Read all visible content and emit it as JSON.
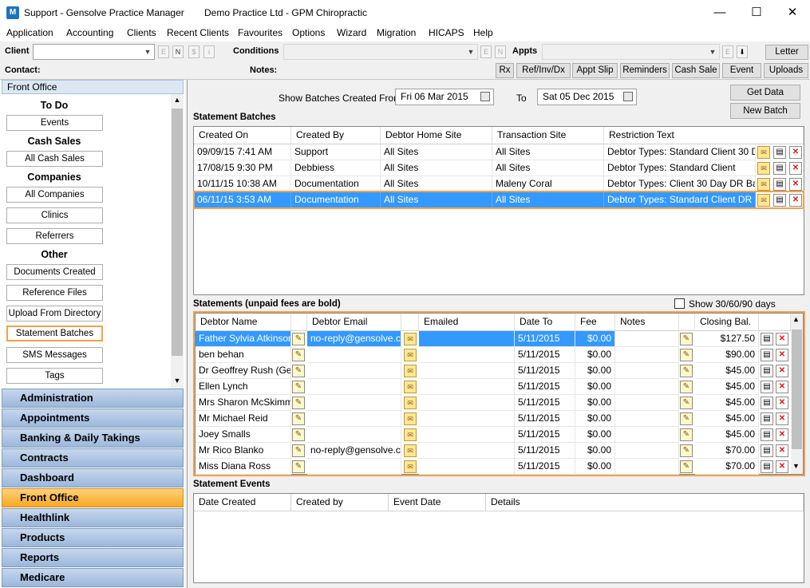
{
  "window": {
    "title": "Support - Gensolve Practice Manager",
    "subtitle": "Demo Practice Ltd - GPM Chiropractic",
    "app_icon": "gensolve-logo-icon",
    "controls": {
      "minimize": "—",
      "maximize": "☐",
      "close": "✕"
    }
  },
  "menu": [
    "Application",
    "Accounting",
    "Clients",
    "Recent Clients",
    "Favourites",
    "Options",
    "Wizard",
    "Migration",
    "HICAPS",
    "Help"
  ],
  "toolbar": {
    "client_label": "Client",
    "client_value": "",
    "client_btns": [
      "E",
      "N",
      "$",
      "i"
    ],
    "conditions_label": "Conditions",
    "conditions_btns": [
      "E",
      "N"
    ],
    "appts_label": "Appts",
    "appts_btns": [
      "E",
      "⬇"
    ],
    "contact_label": "Contact:",
    "notes_label": "Notes:",
    "letter": "Letter",
    "buttons": [
      "Rx",
      "Ref/Inv/Dx",
      "Appt Slip",
      "Reminders",
      "Cash Sale",
      "Event",
      "Uploads"
    ]
  },
  "sidebar": {
    "header": "Front Office",
    "groups": [
      {
        "title": "To Do",
        "items": [
          "Events"
        ]
      },
      {
        "title": "Cash Sales",
        "items": [
          "All Cash Sales"
        ]
      },
      {
        "title": "Companies",
        "items": [
          "All Companies",
          "Clinics",
          "Referrers"
        ]
      },
      {
        "title": "Other",
        "items": [
          "Documents Created",
          "Reference Files",
          "Upload From Directory",
          "Statement Batches",
          "SMS Messages",
          "Tags"
        ]
      }
    ],
    "selected_item": "Statement Batches",
    "nav": [
      "Administration",
      "Appointments",
      "Banking & Daily Takings",
      "Contracts",
      "Dashboard",
      "Front Office",
      "Healthlink",
      "Products",
      "Reports",
      "Medicare"
    ],
    "active_nav": "Front Office"
  },
  "filter": {
    "show_from_label": "Show Batches Created From",
    "from_date": "Fri  06 Mar 2015",
    "to_label": "To",
    "to_date": "Sat  05 Dec 2015",
    "get_data": "Get Data",
    "new_batch": "New Batch"
  },
  "batches": {
    "title": "Statement Batches",
    "columns": [
      "Created On",
      "Created By",
      "Debtor Home Site",
      "Transaction Site",
      "Restriction Text"
    ],
    "rows": [
      [
        "09/09/15 7:41 AM",
        "Support",
        "All Sites",
        "All Sites",
        "Debtor Types: Standard Client 30 D..."
      ],
      [
        "17/08/15 9:30 PM",
        "Debbiess",
        "All Sites",
        "All Sites",
        "Debtor Types: Standard Client"
      ],
      [
        "10/11/15 10:38 AM",
        "Documentation",
        "All Sites",
        "Maleny Coral",
        "Debtor Types: Client 30 Day DR Bal..."
      ],
      [
        "06/11/15 3:53 AM",
        "Documentation",
        "All Sites",
        "All Sites",
        "Debtor Types: Standard Client DR B..."
      ]
    ],
    "selected_row": 3
  },
  "statements": {
    "title": "Statements (unpaid fees are bold)",
    "show_aging_label": "Show 30/60/90 days",
    "columns": [
      "Debtor Name",
      "Debtor Email",
      "Emailed",
      "Date To",
      "Fee",
      "Notes",
      "Closing Bal."
    ],
    "rows": [
      [
        "Father Sylvia Atkinson",
        "no-reply@gensolve.c...",
        "",
        "5/11/2015",
        "$0.00",
        "",
        "$127.50"
      ],
      [
        "ben behan",
        "",
        "",
        "5/11/2015",
        "$0.00",
        "",
        "$90.00"
      ],
      [
        "Dr Geoffrey Rush (Ge...",
        "",
        "",
        "5/11/2015",
        "$0.00",
        "",
        "$45.00"
      ],
      [
        "Ellen Lynch",
        "",
        "",
        "5/11/2015",
        "$0.00",
        "",
        "$45.00"
      ],
      [
        "Mrs Sharon McSkimm...",
        "",
        "",
        "5/11/2015",
        "$0.00",
        "",
        "$45.00"
      ],
      [
        "Mr Michael Reid",
        "",
        "",
        "5/11/2015",
        "$0.00",
        "",
        "$45.00"
      ],
      [
        "Joey Smalls",
        "",
        "",
        "5/11/2015",
        "$0.00",
        "",
        "$45.00"
      ],
      [
        "Mr Rico Blanko",
        "no-reply@gensolve.c...",
        "",
        "5/11/2015",
        "$0.00",
        "",
        "$70.00"
      ],
      [
        "Miss Diana Ross",
        "",
        "",
        "5/11/2015",
        "$0.00",
        "",
        "$70.00"
      ]
    ],
    "selected_row": 0
  },
  "events": {
    "title": "Statement Events",
    "columns": [
      "Date Created",
      "Created by",
      "Event Date",
      "Details"
    ]
  }
}
